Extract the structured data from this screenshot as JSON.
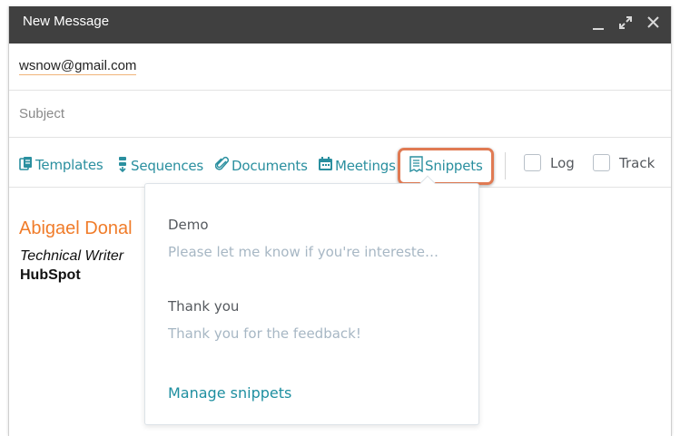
{
  "window": {
    "title": "New Message",
    "controls": [
      "minimize-icon",
      "expand-icon",
      "close-icon"
    ]
  },
  "recipient": {
    "value": "wsnow@gmail.com"
  },
  "subject": {
    "placeholder": "Subject"
  },
  "toolbar": {
    "templates": "Templates",
    "sequences": "Sequences",
    "documents": "Documents",
    "meetings": "Meetings",
    "snippets": "Snippets",
    "log": "Log",
    "track": "Track"
  },
  "signature": {
    "name": "Abigael Donal",
    "role": "Technical Writer",
    "company": "HubSpot"
  },
  "snippets_menu": {
    "items": [
      {
        "title": "Demo",
        "preview": "Please let me know if you're intereste…"
      },
      {
        "title": "Thank you",
        "preview": "Thank you for the feedback!"
      }
    ],
    "manage_label": "Manage snippets"
  },
  "colors": {
    "titlebar": "#404040",
    "link": "#2a8f9f",
    "highlight": "#e07a53",
    "signature_name": "#f07c2a",
    "preview_text": "#a7b7c4"
  }
}
